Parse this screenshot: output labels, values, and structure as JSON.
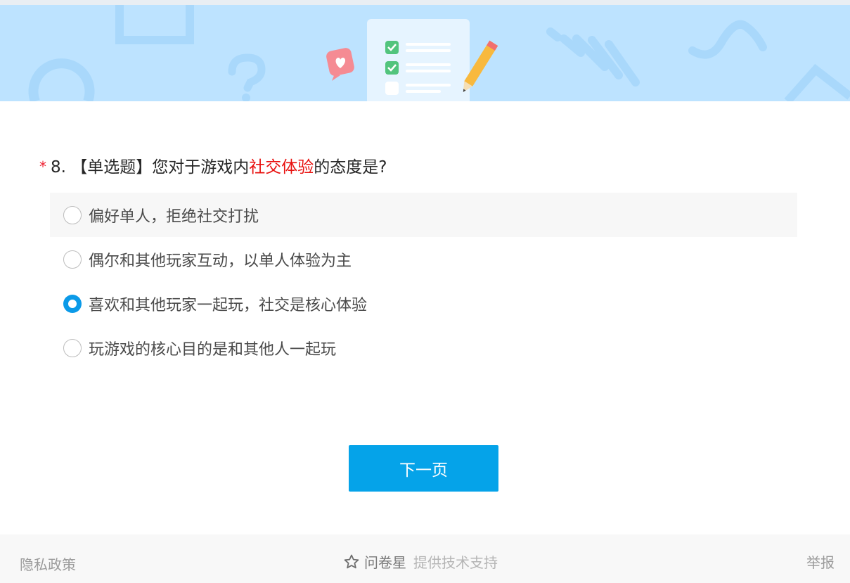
{
  "banner": {
    "background_color": "#bde3ff",
    "illustration": "survey-checklist-with-pencil",
    "icons": [
      "heart-chat-icon",
      "checklist-icon",
      "pencil-icon",
      "question-mark-icon"
    ]
  },
  "question": {
    "required_mark": "*",
    "number": "8.",
    "type_label": "【单选题】",
    "text_before": "您对于游戏内",
    "text_highlight": "社交体验",
    "text_after": "的态度是?",
    "highlight_color": "#e8100e"
  },
  "options": [
    {
      "label": "偏好单人，拒绝社交打扰",
      "checked": false,
      "hover": true
    },
    {
      "label": "偶尔和其他玩家互动，以单人体验为主",
      "checked": false,
      "hover": false
    },
    {
      "label": "喜欢和其他玩家一起玩，社交是核心体验",
      "checked": true,
      "hover": false
    },
    {
      "label": "玩游戏的核心目的是和其他人一起玩",
      "checked": false,
      "hover": false
    }
  ],
  "next_button": {
    "label": "下一页",
    "color": "#05a3e9"
  },
  "footer": {
    "privacy_label": "隐私政策",
    "brand_icon": "star-icon",
    "brand_name": "问卷星",
    "support_label": "提供技术支持",
    "report_label": "举报"
  }
}
